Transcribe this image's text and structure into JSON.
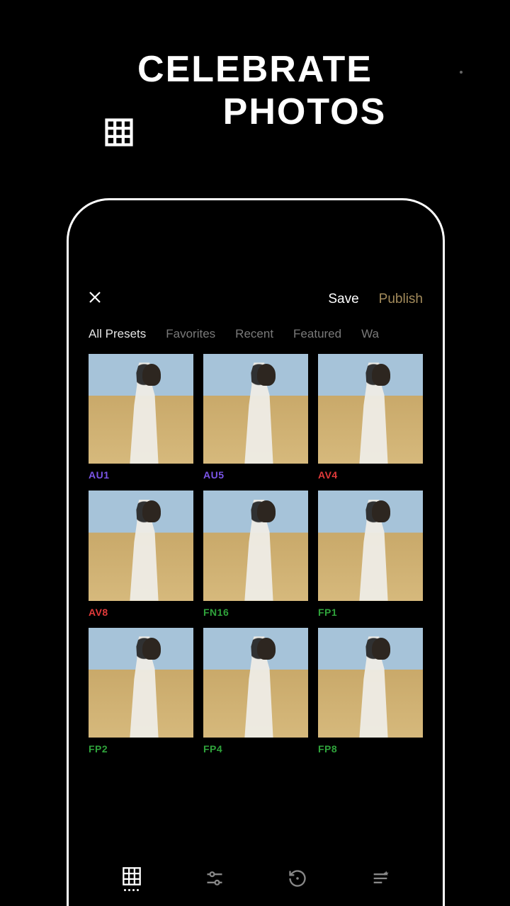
{
  "headline": {
    "line1": "CELEBRATE",
    "line2": "PHOTOS"
  },
  "topbar": {
    "save": "Save",
    "publish": "Publish"
  },
  "tabs": [
    "All Presets",
    "Favorites",
    "Recent",
    "Featured",
    "Wa"
  ],
  "active_tab": 0,
  "presets": [
    {
      "code": "AU1",
      "color": "purple"
    },
    {
      "code": "AU5",
      "color": "purple"
    },
    {
      "code": "AV4",
      "color": "red"
    },
    {
      "code": "AV8",
      "color": "red"
    },
    {
      "code": "FN16",
      "color": "green"
    },
    {
      "code": "FP1",
      "color": "green"
    },
    {
      "code": "FP2",
      "color": "green"
    },
    {
      "code": "FP4",
      "color": "green"
    },
    {
      "code": "FP8",
      "color": "green"
    }
  ],
  "bottom_icons": [
    "grid",
    "sliders",
    "history",
    "list-star"
  ],
  "active_bottom": 0
}
